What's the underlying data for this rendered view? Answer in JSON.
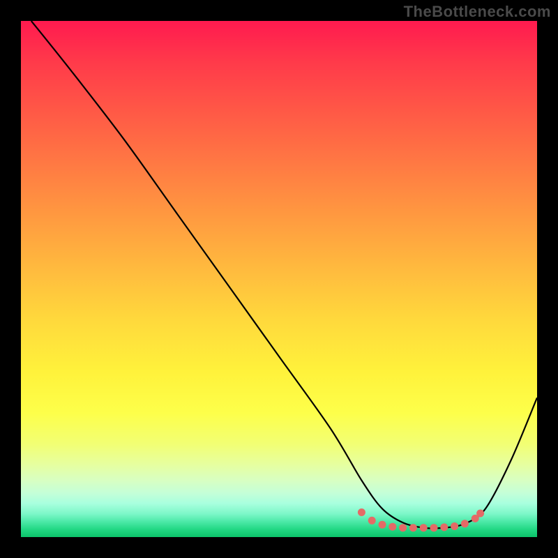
{
  "watermark": "TheBottleneck.com",
  "chart_data": {
    "type": "line",
    "title": "",
    "xlabel": "",
    "ylabel": "",
    "xlim": [
      0,
      100
    ],
    "ylim": [
      0,
      100
    ],
    "series": [
      {
        "name": "bottleneck-curve",
        "x": [
          2,
          10,
          20,
          30,
          40,
          50,
          60,
          66,
          70,
          74,
          78,
          82,
          86,
          90,
          95,
          100
        ],
        "values": [
          100,
          90,
          77,
          63,
          49,
          35,
          21,
          11,
          5.5,
          2.8,
          1.8,
          1.8,
          2.6,
          5.5,
          15,
          27
        ]
      }
    ],
    "markers": {
      "name": "flat-minimum-dots",
      "x": [
        66,
        68,
        70,
        72,
        74,
        76,
        78,
        80,
        82,
        84,
        86,
        88,
        89
      ],
      "values": [
        4.8,
        3.2,
        2.4,
        2.0,
        1.8,
        1.8,
        1.8,
        1.8,
        1.9,
        2.1,
        2.6,
        3.6,
        4.6
      ],
      "color": "#e46a66"
    },
    "curve_color": "#000000",
    "background": "heatmap-gradient"
  }
}
